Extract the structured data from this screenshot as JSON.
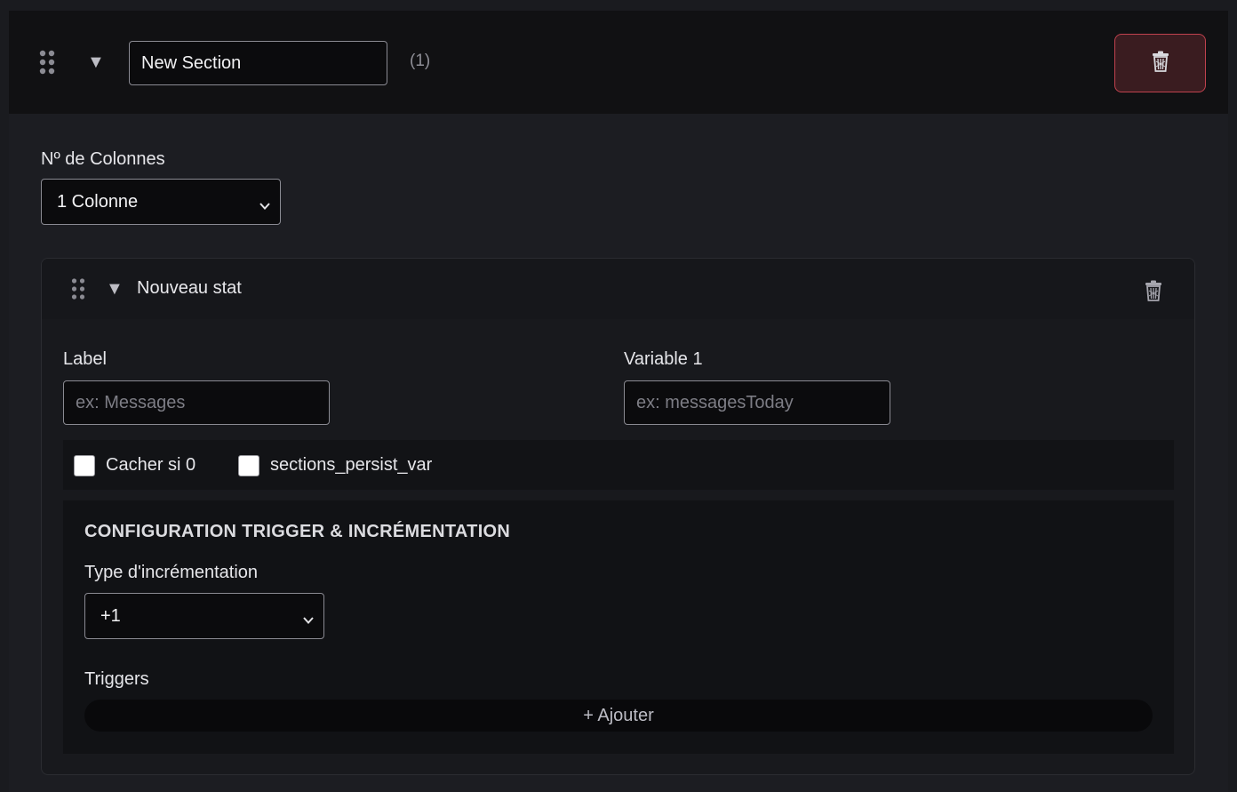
{
  "section": {
    "name": "New Section",
    "count": "(1)",
    "columns_label": "Nº de Colonnes",
    "columns_value": "1 Colonne"
  },
  "stat": {
    "title": "Nouveau stat",
    "label_field": {
      "label": "Label",
      "placeholder": "ex: Messages",
      "value": ""
    },
    "variable_field": {
      "label": "Variable 1",
      "placeholder": "ex: messagesToday",
      "value": ""
    },
    "options": [
      {
        "label": "Cacher si 0",
        "checked": false
      },
      {
        "label": "sections_persist_var",
        "checked": false
      }
    ],
    "config": {
      "title": "CONFIGURATION TRIGGER & INCRÉMENTATION",
      "increment_label": "Type d'incrémentation",
      "increment_value": "+1",
      "triggers_label": "Triggers",
      "add_label": "+ Ajouter"
    }
  },
  "colors": {
    "danger_border": "#c0424e",
    "danger_bg": "#3a1c20",
    "surface": "#1c1d22",
    "header": "#111113"
  },
  "icons": [
    "drag-handle-icon",
    "collapse-arrow-icon",
    "trash-icon",
    "chevron-down-icon"
  ]
}
